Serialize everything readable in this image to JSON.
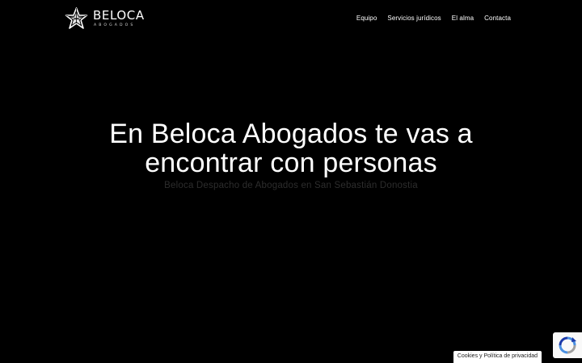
{
  "brand": {
    "name": "BELOCA",
    "subtitle": "ABOGADOS",
    "logo_icon": "star-polygon-icon"
  },
  "nav": {
    "items": [
      {
        "label": "Equipo"
      },
      {
        "label": "Servicios jurídicos"
      },
      {
        "label": "El alma"
      },
      {
        "label": "Contacta"
      }
    ]
  },
  "hero": {
    "title_line1": "En Beloca Abogados te vas a",
    "title_line2": "encontrar con personas",
    "subtitle": "Beloca Despacho de Abogados en San Sebastián Donostia"
  },
  "cookie": {
    "label": "Cookies y Política de privacidad"
  },
  "recaptcha": {
    "icon": "recaptcha-icon"
  },
  "colors": {
    "background": "#000000",
    "text": "#ffffff",
    "subtitle": "#2d2d2d"
  }
}
